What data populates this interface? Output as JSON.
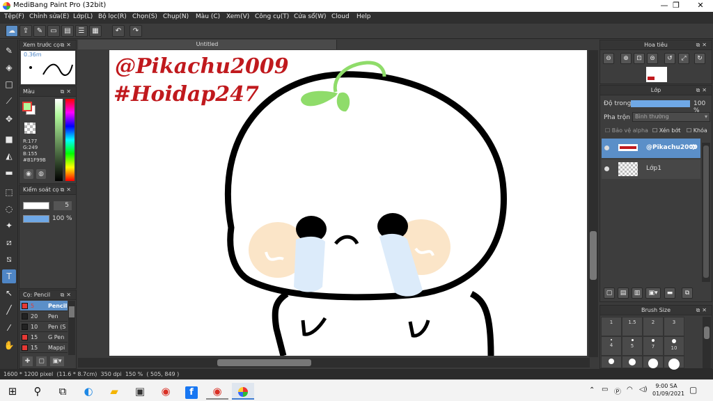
{
  "window": {
    "title": "MediBang Paint Pro (32bit)",
    "controls": {
      "minimize": "—",
      "maximize": "❐",
      "close": "✕"
    }
  },
  "menu": [
    "Tệp(F)",
    "Chỉnh sửa(E)",
    "Lớp(L)",
    "Bộ lọc(R)",
    "Chọn(S)",
    "Chụp(N)",
    "Màu (C)",
    "Xem(V)",
    "Công cụ(T)",
    "Cửa sổ(W)",
    "Cloud",
    "Help"
  ],
  "panels": {
    "preview": {
      "title": "Xem trước cọ",
      "size": "0.36m"
    },
    "color": {
      "title": "Màu",
      "r": "R:177",
      "g": "G:249",
      "b": "B:155",
      "hex": "#B1F99B",
      "primary": "#B1F99B"
    },
    "control": {
      "title": "Kiểm soát cọ",
      "size_value": "5",
      "opacity_value": "100 %"
    },
    "brush": {
      "title": "Cọ: Pencil",
      "items": [
        {
          "size": "5",
          "name": "Pencil",
          "color": "#e53935",
          "active": true
        },
        {
          "size": "20",
          "name": "Pen",
          "color": "#222222",
          "active": false
        },
        {
          "size": "10",
          "name": "Pen (S",
          "color": "#222222",
          "active": false
        },
        {
          "size": "15",
          "name": "G Pen",
          "color": "#e53935",
          "active": false
        },
        {
          "size": "15",
          "name": "Mappi",
          "color": "#e53935",
          "active": false
        }
      ]
    },
    "navigator": {
      "title": "Hoa tiêu"
    },
    "layers": {
      "title": "Lớp",
      "opacity_label": "Độ trong",
      "opacity_value": "100 %",
      "blend_label": "Pha trộn",
      "blend_value": "Bình thường",
      "protect_alpha": "Bảo vệ alpha",
      "clipping": "Xén bớt",
      "lock": "Khóa",
      "items": [
        {
          "name": "@Pikachu2009",
          "active": true
        },
        {
          "name": "Lớp1",
          "active": false
        }
      ]
    },
    "brush_size": {
      "title": "Brush Size",
      "labels": [
        "1",
        "1.5",
        "2",
        "3",
        "4",
        "5",
        "7",
        "10"
      ]
    }
  },
  "canvas": {
    "tab_title": "Untitled",
    "watermark_line1": "@Pikachu2009",
    "watermark_line2": "#Hoidap247"
  },
  "status": {
    "size": "1600 * 1200 pixel",
    "physical": "(11.6 * 8.7cm)",
    "dpi": "350 dpi",
    "zoom": "150 %",
    "cursor": "( 505, 849 )"
  },
  "taskbar": {
    "time": "9:00 SA",
    "date": "01/09/2021"
  },
  "colors": {
    "accent": "#4f86c6",
    "sprout": "#8fdc6a",
    "blush": "#fbe5c8",
    "tears": "#dcebfa",
    "watermark": "#c0191d"
  }
}
